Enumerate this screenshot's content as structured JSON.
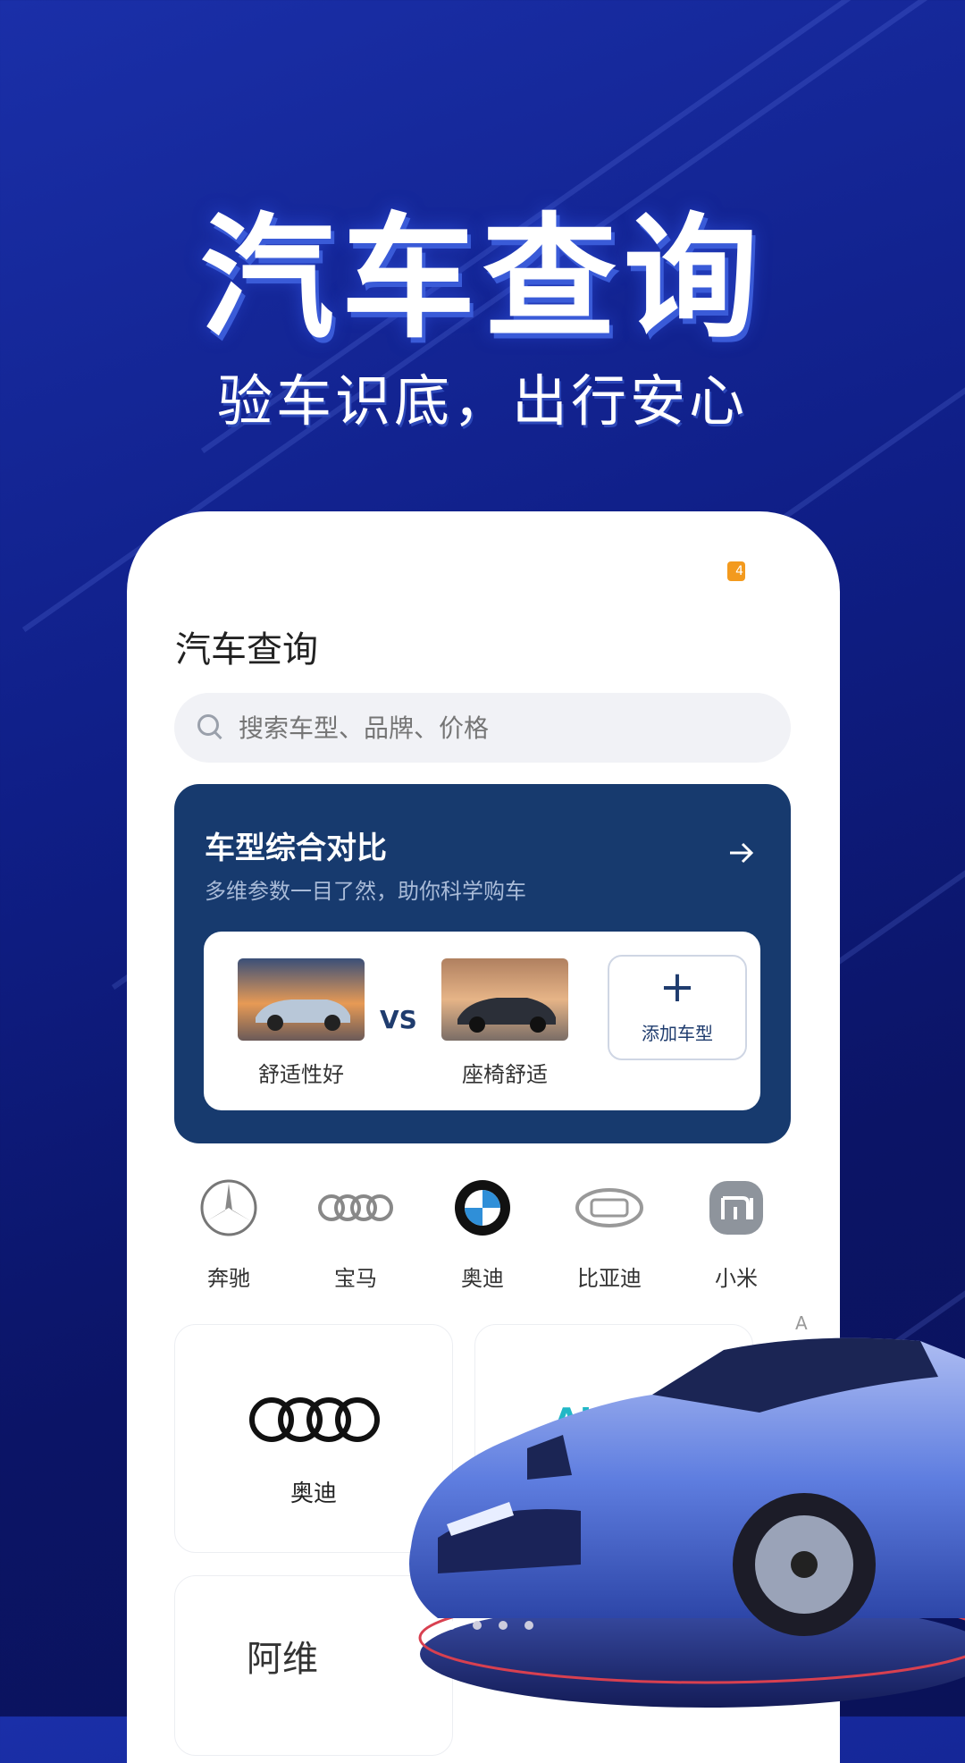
{
  "hero": {
    "title": "汽车查询",
    "subtitle": "验车识底，出行安心"
  },
  "status": {
    "badge": "4"
  },
  "app": {
    "title": "汽车查询"
  },
  "search": {
    "placeholder": "搜索车型、品牌、价格"
  },
  "compare": {
    "title": "车型综合对比",
    "subtitle": "多维参数一目了然，助你科学购车",
    "car1_label": "舒适性好",
    "vs": "VS",
    "car2_label": "座椅舒适",
    "add_label": "添加车型",
    "add_icon": "plus-icon"
  },
  "brands": [
    {
      "name": "奔驰",
      "icon": "mercedes-logo"
    },
    {
      "name": "宝马",
      "icon": "audi-rings-logo"
    },
    {
      "name": "奥迪",
      "icon": "bmw-logo"
    },
    {
      "name": "比亚迪",
      "icon": "byd-logo"
    },
    {
      "name": "小米",
      "icon": "xiaomi-logo"
    }
  ],
  "cards": [
    {
      "name": "奥迪",
      "logo": "audi-rings-logo"
    },
    {
      "name": "",
      "logo_text": "AION"
    },
    {
      "name": "",
      "logo_text": "阿维"
    }
  ],
  "index_letter": "A",
  "carousel": {
    "total": 4,
    "active": 0
  }
}
